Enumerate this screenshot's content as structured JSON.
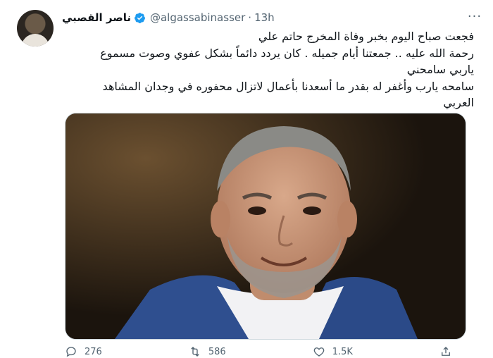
{
  "tweet": {
    "author_name": "ناصر القصبي",
    "handle": "@algassabinasser",
    "separator": "·",
    "time": "13h",
    "more_label": "···",
    "lines": [
      "فجعت صباح اليوم بخبر وفاة المخرج حاتم علي",
      "رحمة الله عليه .. جمعتنا أيام جميله . كان يردد دائماً بشكل عفوي وصوت مسموع",
      "ياربي سامحني",
      "سامحه يارب وأغفر له بقدر ما أسعدنا بأعمال لاتزال محفوره في وجدان المشاهد",
      "العربي"
    ]
  },
  "actions": {
    "reply_count": "276",
    "retweet_count": "586",
    "like_count": "1.5K"
  },
  "colors": {
    "verified_blue": "#1d9bf0",
    "muted": "#536471"
  },
  "icons": [
    "verified-badge-icon",
    "more-icon",
    "reply-icon",
    "retweet-icon",
    "like-icon",
    "share-icon"
  ]
}
